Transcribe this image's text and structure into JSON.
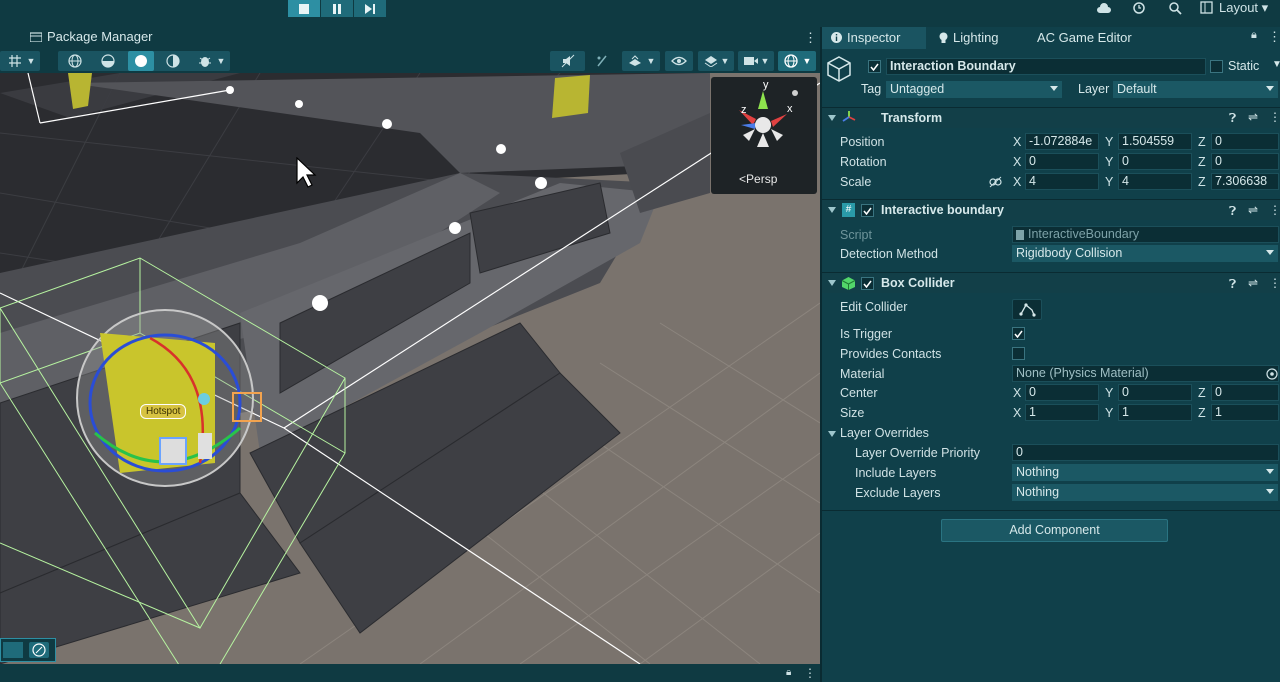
{
  "toolbar": {
    "layout_label": "Layout",
    "icons": [
      "stop-icon",
      "pause-icon",
      "step-icon",
      "cloud-icon",
      "history-icon",
      "search-icon",
      "layout-icon"
    ]
  },
  "scene": {
    "tab_label": "Package Manager",
    "gizmo": {
      "y": "y",
      "x": "x",
      "z": "z",
      "persp_label": "Persp"
    },
    "hotspot_label": "Hotspot"
  },
  "inspector": {
    "tabs": [
      {
        "label": "Inspector",
        "icon": "info-icon"
      },
      {
        "label": "Lighting",
        "icon": "bulb-icon"
      },
      {
        "label": "AC Game Editor",
        "icon": ""
      }
    ],
    "object_name": "Interaction Boundary",
    "static_label": "Static",
    "tag_label": "Tag",
    "tag_value": "Untagged",
    "layer_label": "Layer",
    "layer_value": "Default",
    "transform": {
      "title": "Transform",
      "position_label": "Position",
      "rotation_label": "Rotation",
      "scale_label": "Scale",
      "position": {
        "x": "-1.072884e",
        "y": "1.504559",
        "z": "0"
      },
      "rotation": {
        "x": "0",
        "y": "0",
        "z": "0"
      },
      "scale": {
        "x": "4",
        "y": "4",
        "z": "7.306638"
      }
    },
    "script_comp": {
      "title": "Interactive boundary",
      "script_label": "Script",
      "script_value": "InteractiveBoundary",
      "detection_label": "Detection Method",
      "detection_value": "Rigidbody Collision"
    },
    "box_collider": {
      "title": "Box Collider",
      "edit_label": "Edit Collider",
      "is_trigger_label": "Is Trigger",
      "is_trigger": true,
      "provides_contacts_label": "Provides Contacts",
      "provides_contacts": false,
      "material_label": "Material",
      "material_value": "None (Physics Material)",
      "center_label": "Center",
      "center": {
        "x": "0",
        "y": "0",
        "z": "0"
      },
      "size_label": "Size",
      "size": {
        "x": "1",
        "y": "1",
        "z": "1"
      },
      "layer_overrides_label": "Layer Overrides",
      "priority_label": "Layer Override Priority",
      "priority_value": "0",
      "include_label": "Include Layers",
      "include_value": "Nothing",
      "exclude_label": "Exclude Layers",
      "exclude_value": "Nothing"
    },
    "add_component_label": "Add Component"
  },
  "axis_labels": {
    "x": "X",
    "y": "Y",
    "z": "Z"
  },
  "colors": {
    "panel": "#10404a",
    "accent": "#2d8fa3",
    "field": "#0b2e35"
  }
}
